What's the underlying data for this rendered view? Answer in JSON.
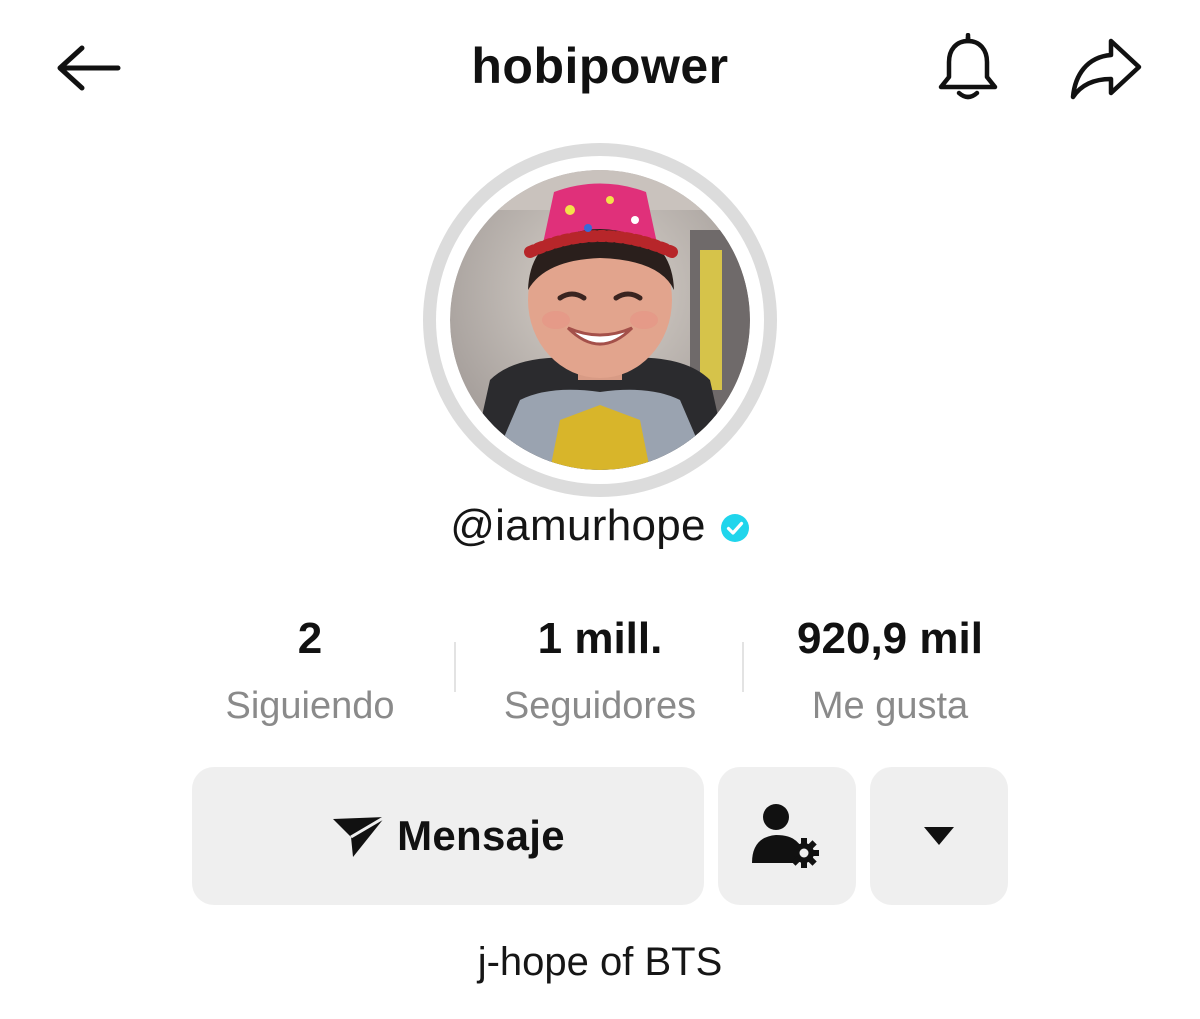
{
  "header": {
    "title": "hobipower",
    "back_icon": "arrow-left-icon",
    "bell_icon": "bell-icon",
    "share_icon": "share-arrow-icon"
  },
  "profile": {
    "avatar_description_icon": "avatar-photo",
    "handle": "@iamurhope",
    "verified_icon": "verified-badge-icon",
    "verified_color": "#20d5ec"
  },
  "stats": [
    {
      "value": "2",
      "label": "Siguiendo"
    },
    {
      "value": "1 mill.",
      "label": "Seguidores"
    },
    {
      "value": "920,9 mil",
      "label": "Me gusta"
    }
  ],
  "actions": {
    "message_label": "Mensaje",
    "message_icon": "send-plane-icon",
    "friend_icon": "user-settings-icon",
    "more_icon": "caret-down-icon"
  },
  "bio": "j-hope of BTS",
  "colors": {
    "button_bg": "#efefef",
    "secondary_text": "#8a8a8a",
    "avatar_ring": "#dcdcdc"
  }
}
